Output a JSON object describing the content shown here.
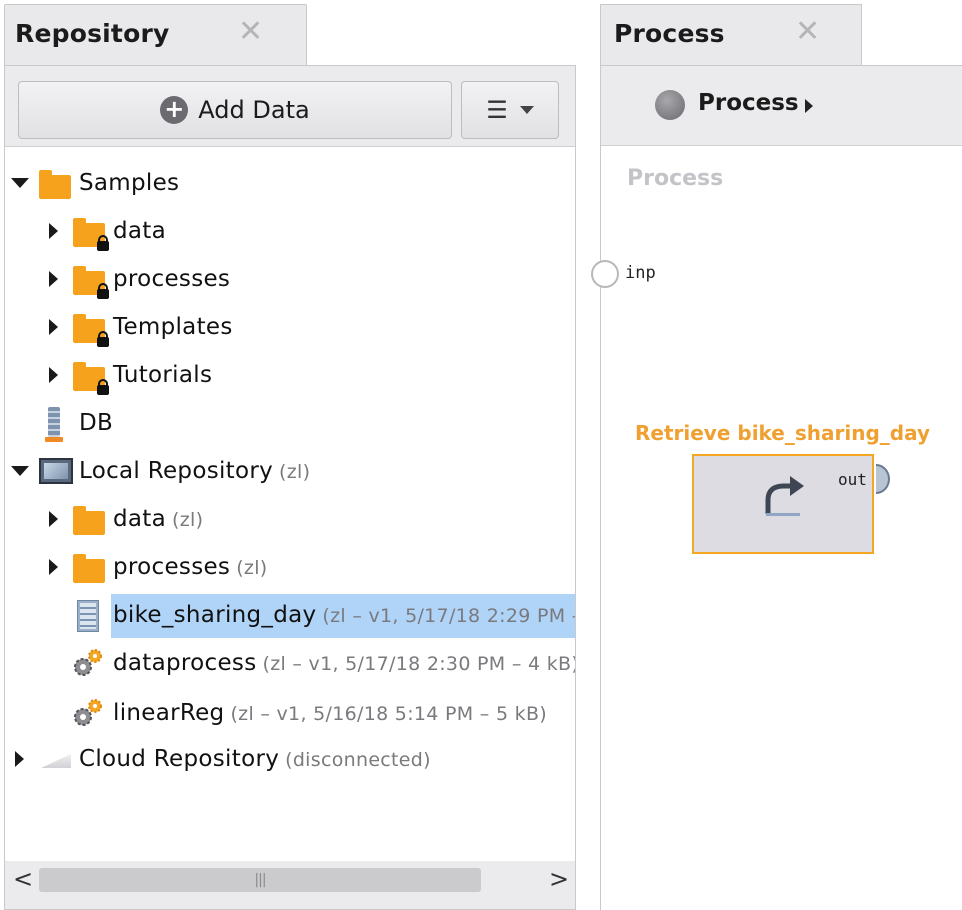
{
  "repository": {
    "tab_title": "Repository",
    "close_glyph": "✕",
    "add_data_label": "Add Data",
    "menu_glyph": "☰",
    "tree": [
      {
        "label": "Samples",
        "meta": "",
        "icon": "folder-icon",
        "expanded": true
      },
      {
        "label": "data",
        "meta": "",
        "icon": "locked-folder-icon"
      },
      {
        "label": "processes",
        "meta": "",
        "icon": "locked-folder-icon"
      },
      {
        "label": "Templates",
        "meta": "",
        "icon": "locked-folder-icon"
      },
      {
        "label": "Tutorials",
        "meta": "",
        "icon": "locked-folder-icon"
      },
      {
        "label": "DB",
        "meta": "",
        "icon": "database-icon"
      },
      {
        "label": "Local Repository",
        "meta": "(zl)",
        "icon": "monitor-icon",
        "expanded": true
      },
      {
        "label": "data",
        "meta": "(zl)",
        "icon": "folder-icon"
      },
      {
        "label": "processes",
        "meta": "(zl)",
        "icon": "folder-icon"
      },
      {
        "label": "bike_sharing_day",
        "meta": "(zl – v1, 5/17/18 2:29 PM –",
        "icon": "dataset-icon",
        "selected": true
      },
      {
        "label": "dataprocess",
        "meta": "(zl – v1, 5/17/18 2:30 PM – 4 kB)",
        "icon": "process-gear-icon"
      },
      {
        "label": "linearReg",
        "meta": "(zl – v1, 5/16/18 5:14 PM – 5 kB)",
        "icon": "process-gear-icon"
      },
      {
        "label": "Cloud Repository",
        "meta": "(disconnected)",
        "icon": "cloud-icon"
      }
    ],
    "scroll_left": "<",
    "scroll_right": ">",
    "scroll_grip": "|||"
  },
  "process": {
    "tab_title": "Process",
    "close_glyph": "✕",
    "breadcrumb_label": "Process",
    "canvas_title": "Process",
    "input_port_label": "inp",
    "operator_title": "Retrieve bike_sharing_day",
    "operator_out_label": "out"
  },
  "colors": {
    "accent_orange": "#f5a623",
    "selection_blue": "#b0d4f7",
    "folder_orange": "#f7a21c"
  }
}
